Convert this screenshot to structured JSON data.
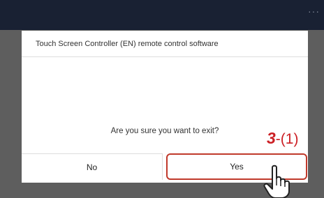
{
  "topbar": {
    "menu_icon": "more-dots-icon",
    "menu_glyph": "···"
  },
  "dialog": {
    "title": "Touch Screen Controller (EN)  remote control software",
    "message": "Are you sure you want to exit?",
    "no_label": "No",
    "yes_label": "Yes"
  },
  "annotation": {
    "step_number": "3",
    "step_suffix": "-(1)",
    "pointer_icon": "hand-pointer-icon"
  },
  "colors": {
    "topbar": "#192133",
    "overlay": "#5e5e5e",
    "highlight": "#c0392b",
    "annotation": "#cc1f24"
  }
}
